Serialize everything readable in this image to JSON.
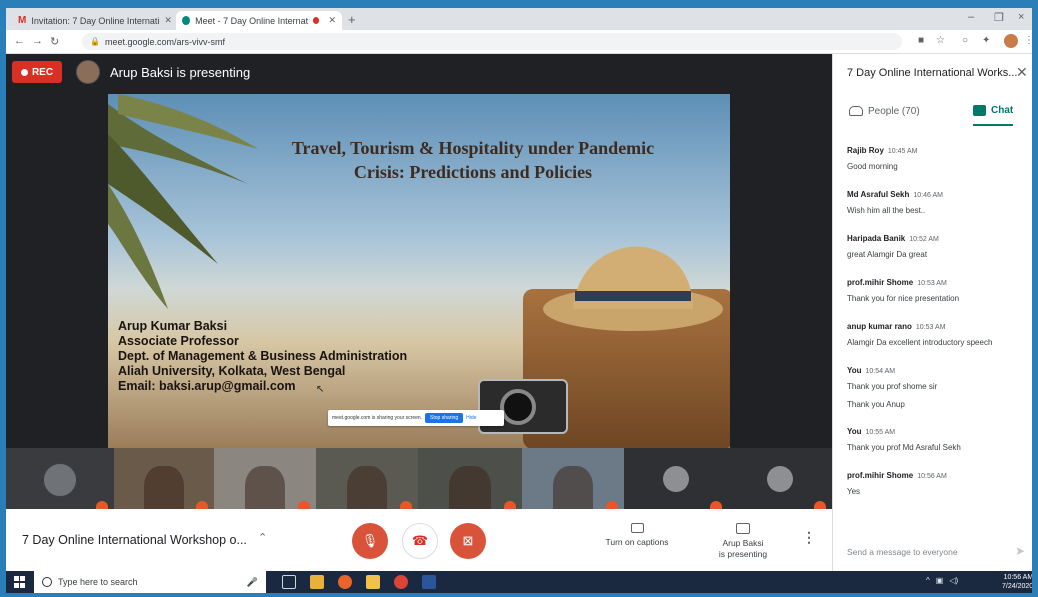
{
  "browser": {
    "tabs": [
      {
        "label": "Invitation: 7 Day Online Internati"
      },
      {
        "label": "Meet - 7 Day Online Internat"
      }
    ],
    "new_tab": "+",
    "url": "meet.google.com/ars-vivv-smf",
    "win_min": "–",
    "win_max": "❐",
    "win_close": "×"
  },
  "meet": {
    "rec_label": "REC",
    "presenter_banner": "Arup Baksi is presenting",
    "slide": {
      "title_line1": "Travel, Tourism & Hospitality under Pandemic",
      "title_line2": "Crisis: Predictions and Policies",
      "info": [
        "Arup Kumar Baksi",
        "Associate Professor",
        "Dept. of Management & Business Administration",
        "Aliah University, Kolkata, West Bengal",
        "Email: baksi.arup@gmail.com"
      ],
      "share_text": "meet.google.com is sharing your screen.",
      "stop_sharing": "Stop sharing",
      "hide": "Hide"
    },
    "participant_tiles": [
      {
        "type": "avatar",
        "bg": "#3a3b3e",
        "width": 108
      },
      {
        "type": "video",
        "bg": "#6a5a4a",
        "width": 100
      },
      {
        "type": "video",
        "bg": "#8b8680",
        "width": 102
      },
      {
        "type": "video",
        "bg": "#5b5a52",
        "width": 102
      },
      {
        "type": "video",
        "bg": "#4c4f4a",
        "width": 104
      },
      {
        "type": "video",
        "bg": "#6b7a86",
        "width": 102
      },
      {
        "type": "small-avatar",
        "bg": "#2f3033",
        "width": 104
      },
      {
        "type": "small-avatar",
        "bg": "#2f3033",
        "width": 104
      }
    ]
  },
  "bottombar": {
    "meeting_title": "7 Day Online International Workshop o...",
    "captions_label": "Turn on captions",
    "presenting_label_1": "Arup Baksi",
    "presenting_label_2": "is presenting"
  },
  "panel": {
    "title": "7 Day Online International Works...",
    "people_tab": "People (70)",
    "chat_tab": "Chat",
    "messages": [
      {
        "sender": "Rajib Roy",
        "time": "10:45 AM",
        "text": "Good morning"
      },
      {
        "sender": "Md Asraful Sekh",
        "time": "10:46 AM",
        "text": "Wish him all the best.."
      },
      {
        "sender": "Haripada Banik",
        "time": "10:52 AM",
        "text": "great Alamgir Da great"
      },
      {
        "sender": "prof.mihir Shome",
        "time": "10:53 AM",
        "text": "Thank you for nice presentation"
      },
      {
        "sender": "anup kumar rano",
        "time": "10:53 AM",
        "text": "Alamgir Da excellent introductory speech"
      },
      {
        "sender": "You",
        "time": "10:54 AM",
        "text": "Thank you prof shome sir",
        "text2": "Thank you Anup"
      },
      {
        "sender": "You",
        "time": "10:55 AM",
        "text": "Thank you prof Md Asraful Sekh"
      },
      {
        "sender": "prof.mihir Shome",
        "time": "10:56 AM",
        "text": "Yes"
      }
    ],
    "compose_placeholder": "Send a message to everyone"
  },
  "taskbar": {
    "search_placeholder": "Type here to search",
    "time": "10:56 AM",
    "date": "7/24/2020"
  },
  "colors": {
    "accent_teal": "#00796b",
    "rec_red": "#d93025",
    "control_red": "#d9533a"
  }
}
